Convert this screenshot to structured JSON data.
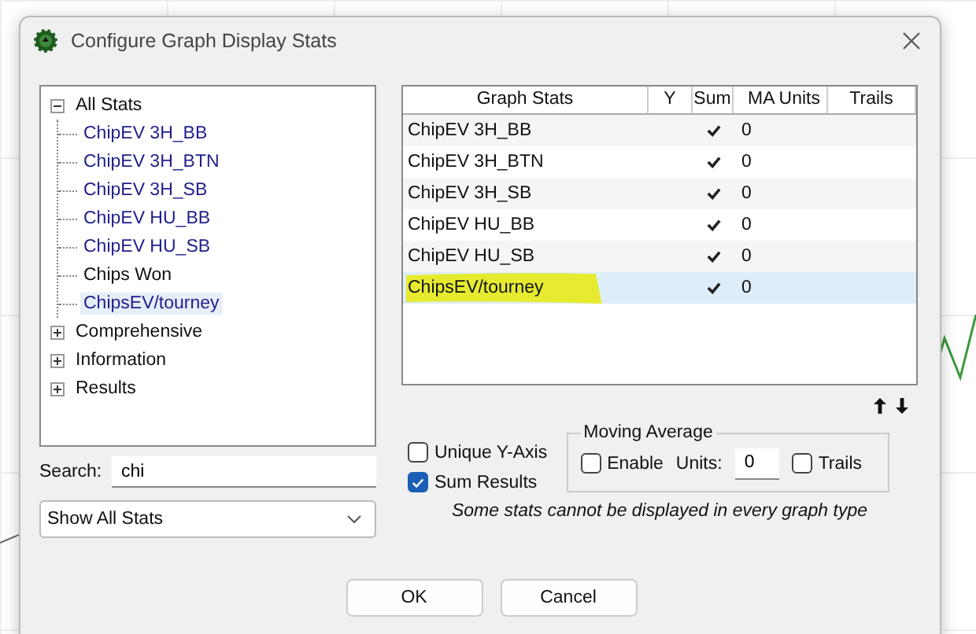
{
  "window": {
    "title": "Configure Graph Display Stats"
  },
  "tree": [
    {
      "label": "All Stats",
      "expanded": true,
      "children": [
        {
          "label": "ChipEV 3H_BB",
          "in_graph": true,
          "selected": false
        },
        {
          "label": "ChipEV 3H_BTN",
          "in_graph": true,
          "selected": false
        },
        {
          "label": "ChipEV 3H_SB",
          "in_graph": true,
          "selected": false
        },
        {
          "label": "ChipEV HU_BB",
          "in_graph": true,
          "selected": false
        },
        {
          "label": "ChipEV HU_SB",
          "in_graph": true,
          "selected": false
        },
        {
          "label": "Chips Won",
          "in_graph": false,
          "selected": false
        },
        {
          "label": "ChipsEV/tourney",
          "in_graph": true,
          "selected": true
        }
      ]
    },
    {
      "label": "Comprehensive",
      "expanded": false
    },
    {
      "label": "Information",
      "expanded": false
    },
    {
      "label": "Results",
      "expanded": false
    }
  ],
  "search": {
    "label": "Search:",
    "value": "chi"
  },
  "filter": {
    "value": "Show All Stats"
  },
  "table": {
    "columns": [
      "Graph Stats",
      "Y",
      "Sum",
      "MA Units",
      "Trails"
    ],
    "rows": [
      {
        "name": "ChipEV 3H_BB",
        "y": false,
        "sum": true,
        "ma_units": "0",
        "trails": false,
        "selected": false,
        "highlighted": false
      },
      {
        "name": "ChipEV 3H_BTN",
        "y": false,
        "sum": true,
        "ma_units": "0",
        "trails": false,
        "selected": false,
        "highlighted": false
      },
      {
        "name": "ChipEV 3H_SB",
        "y": false,
        "sum": true,
        "ma_units": "0",
        "trails": false,
        "selected": false,
        "highlighted": false
      },
      {
        "name": "ChipEV HU_BB",
        "y": false,
        "sum": true,
        "ma_units": "0",
        "trails": false,
        "selected": false,
        "highlighted": false
      },
      {
        "name": "ChipEV HU_SB",
        "y": false,
        "sum": true,
        "ma_units": "0",
        "trails": false,
        "selected": false,
        "highlighted": false
      },
      {
        "name": "ChipsEV/tourney",
        "y": false,
        "sum": true,
        "ma_units": "0",
        "trails": false,
        "selected": true,
        "highlighted": true
      }
    ]
  },
  "options": [
    {
      "label": "Unique Y-Axis",
      "checked": false
    },
    {
      "label": "Sum Results",
      "checked": true
    }
  ],
  "moving_average": {
    "title": "Moving Average",
    "enable": {
      "label": "Enable",
      "checked": false
    },
    "units_label": "Units:",
    "units": "0",
    "trails": {
      "label": "Trails",
      "checked": false
    }
  },
  "note": "Some stats cannot be displayed in every graph type",
  "buttons": [
    "OK",
    "Cancel"
  ]
}
